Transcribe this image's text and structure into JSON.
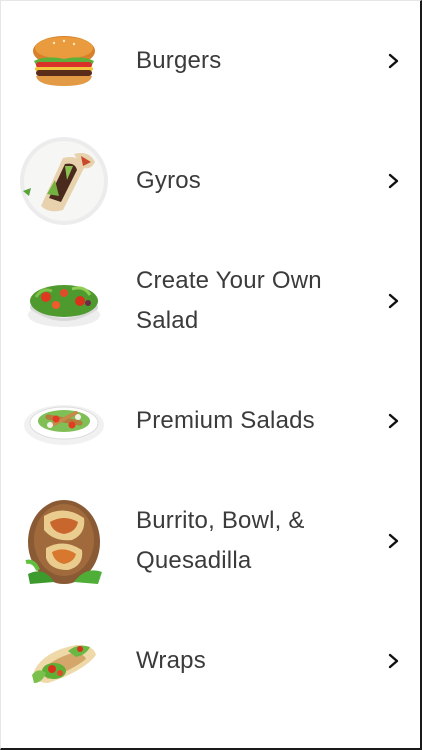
{
  "menu": {
    "items": [
      {
        "label": "Burgers",
        "icon": "burger-icon"
      },
      {
        "label": "Gyros",
        "icon": "gyro-icon"
      },
      {
        "label": "Create Your Own Salad",
        "icon": "salad-bowl-icon"
      },
      {
        "label": "Premium Salads",
        "icon": "premium-salad-icon"
      },
      {
        "label": "Burrito, Bowl, & Quesadilla",
        "icon": "burrito-icon"
      },
      {
        "label": "Wraps",
        "icon": "wrap-icon"
      }
    ],
    "chevron_icon": "chevron-right-icon"
  },
  "colors": {
    "text": "#3b3b3b",
    "chevron": "#111111",
    "background": "#ffffff"
  }
}
